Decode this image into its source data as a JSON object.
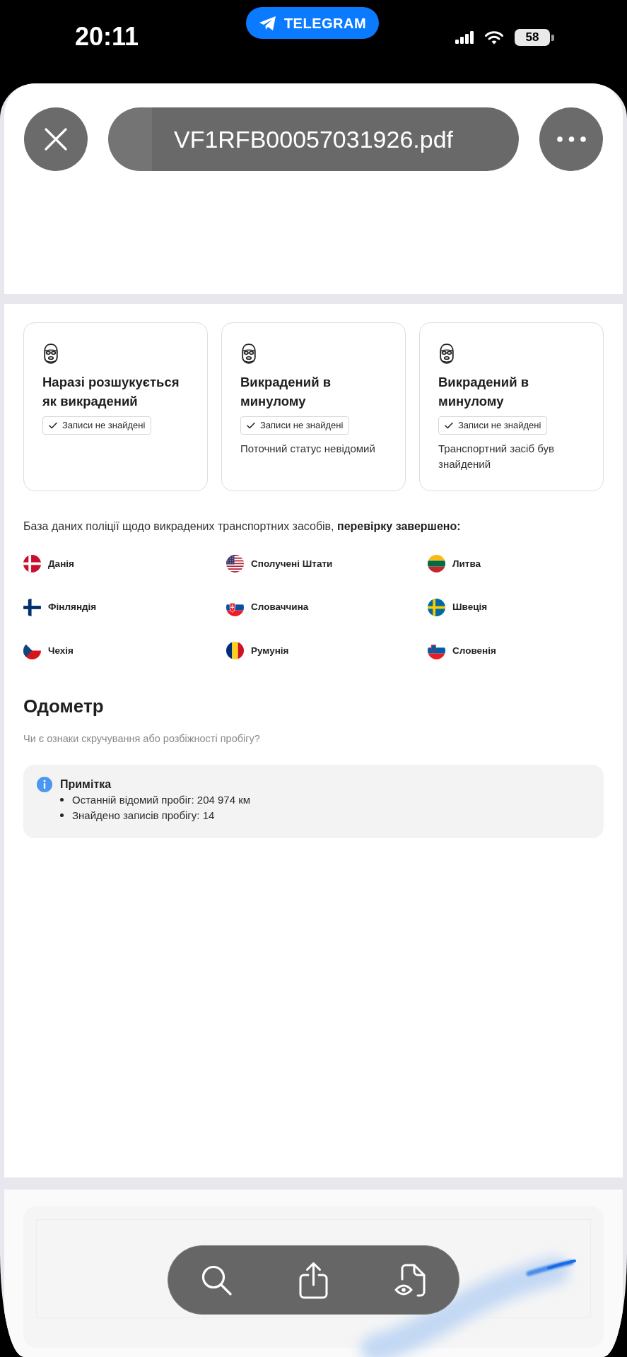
{
  "status_bar": {
    "time": "20:11",
    "app_pill": "TELEGRAM",
    "battery": "58"
  },
  "header": {
    "title": "VF1RFB00057031926.pdf"
  },
  "theft_checks": [
    {
      "title": "Наразі розшукується як викрадений",
      "badge": "Записи не знайдені"
    },
    {
      "title": "Викрадений в минулому",
      "badge": "Записи не знайдені",
      "description": "Поточний статус невідомий"
    },
    {
      "title": "Викрадений в минулому",
      "badge": "Записи не знайдені",
      "description": "Транспортний засіб був знайдений"
    }
  ],
  "police_database": {
    "text": "База даних поліції щодо викрадених транспортних засобів, **перевірку завершено:**",
    "countries": [
      {
        "name": "Данія",
        "kind": "dk"
      },
      {
        "name": "Сполучені Штати",
        "kind": "us"
      },
      {
        "name": "Литва",
        "kind": "lt"
      },
      {
        "name": "Фінляндія",
        "kind": "fi"
      },
      {
        "name": "Словаччина",
        "kind": "sk"
      },
      {
        "name": "Швеція",
        "kind": "se"
      },
      {
        "name": "Чехія",
        "kind": "cz"
      },
      {
        "name": "Румунія",
        "kind": "ro"
      },
      {
        "name": "Словенія",
        "kind": "si"
      }
    ]
  },
  "odometer": {
    "title": "Одометр",
    "question": "Чи є ознаки скручування або розбіжності пробігу?",
    "note": {
      "title": "Примітка",
      "items": [
        "Останній відомий пробіг: 204 974 км",
        "Знайдено записів пробігу: 14"
      ]
    }
  }
}
